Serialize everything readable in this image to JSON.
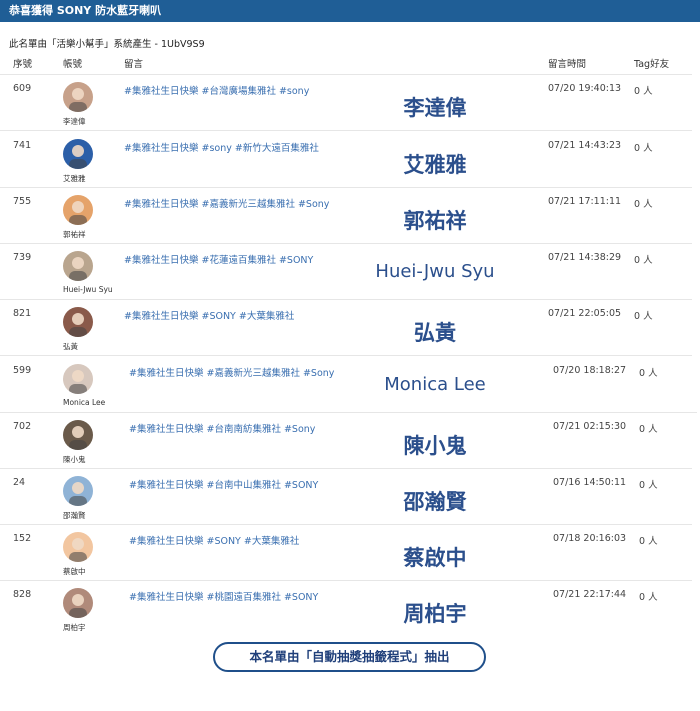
{
  "header": {
    "title": "恭喜獲得 SONY 防水藍牙喇叭"
  },
  "source_line": "此名單由「活樂小幫手」系統產生 - 1UbV9S9",
  "columns": {
    "seq": "序號",
    "account": "帳號",
    "message": "留言",
    "time": "留言時間",
    "tag": "Tag好友"
  },
  "rows": [
    {
      "seq": "609",
      "account": "李達偉",
      "message": "#集雅社生日快樂 #台灣廣場集雅社 #sony",
      "winner": "李達偉",
      "time": "07/20 19:40:13",
      "tag": "0 人",
      "avatar_color": "#c7a18a"
    },
    {
      "seq": "741",
      "account": "艾雅雅",
      "message": "#集雅社生日快樂 #sony #新竹大遠百集雅社",
      "winner": "艾雅雅",
      "time": "07/21 14:43:23",
      "tag": "0 人",
      "avatar_color": "#2c5fa8"
    },
    {
      "seq": "755",
      "account": "郭祐祥",
      "message": "#集雅社生日快樂 #嘉義新光三越集雅社 #Sony",
      "winner": "郭祐祥",
      "time": "07/21 17:11:11",
      "tag": "0 人",
      "avatar_color": "#e5a36a"
    },
    {
      "seq": "739",
      "account": "Huei-Jwu Syu",
      "message": "#集雅社生日快樂 #花蓮遠百集雅社 #SONY",
      "winner": "Huei-Jwu Syu",
      "time": "07/21 14:38:29",
      "tag": "0 人",
      "avatar_color": "#b9a58e"
    },
    {
      "seq": "821",
      "account": "弘黃",
      "message": "#集雅社生日快樂 #SONY #大葉集雅社",
      "winner": "弘黃",
      "time": "07/21 22:05:05",
      "tag": "0 人",
      "avatar_color": "#8a5a4a"
    },
    {
      "seq": "599",
      "account": "Monica Lee",
      "message": "#集雅社生日快樂 #嘉義新光三越集雅社 #Sony",
      "winner": "Monica Lee",
      "time": "07/20 18:18:27",
      "tag": "0 人",
      "avatar_color": "#d7c8be"
    },
    {
      "seq": "702",
      "account": "陳小鬼",
      "message": "#集雅社生日快樂 #台南南紡集雅社 #Sony",
      "winner": "陳小鬼",
      "time": "07/21 02:15:30",
      "tag": "0 人",
      "avatar_color": "#6a5a4a"
    },
    {
      "seq": "24",
      "account": "邵瀚賢",
      "message": "#集雅社生日快樂 #台南中山集雅社 #SONY",
      "winner": "邵瀚賢",
      "time": "07/16 14:50:11",
      "tag": "0 人",
      "avatar_color": "#8fb3d6"
    },
    {
      "seq": "152",
      "account": "蔡啟中",
      "message": "#集雅社生日快樂 #SONY #大葉集雅社",
      "winner": "蔡啟中",
      "time": "07/18 20:16:03",
      "tag": "0 人",
      "avatar_color": "#f2c6a0"
    },
    {
      "seq": "828",
      "account": "周柏宇",
      "message": "#集雅社生日快樂 #桃園遠百集雅社 #SONY",
      "winner": "周柏宇",
      "time": "07/21 22:17:44",
      "tag": "0 人",
      "avatar_color": "#b08a7a"
    }
  ],
  "footer": {
    "label": "本名單由「自動抽獎抽籤程式」抽出"
  }
}
